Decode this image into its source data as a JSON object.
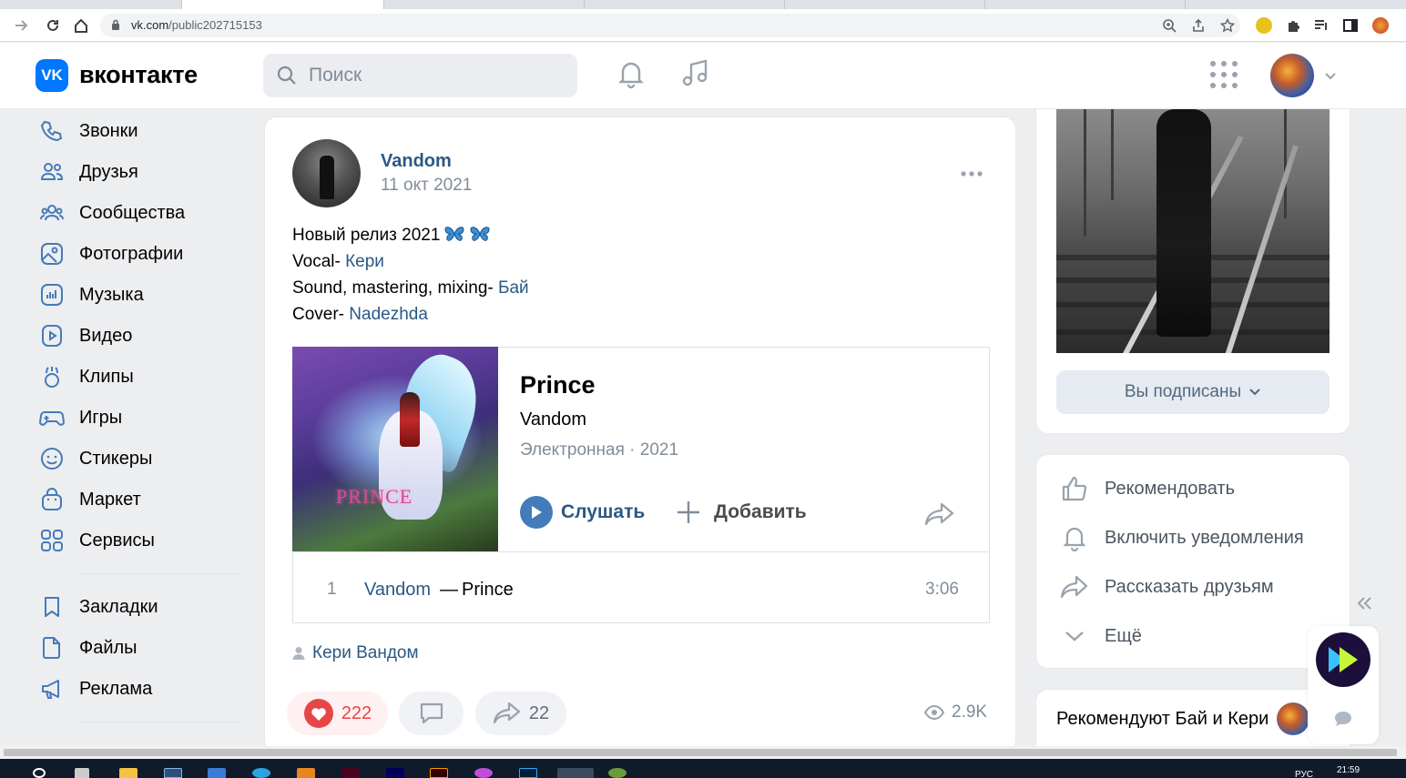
{
  "browser": {
    "url_host": "vk.com",
    "url_path": "/public202715153"
  },
  "header": {
    "logo_text": "VK",
    "brand": "вконтакте",
    "search_placeholder": "Поиск"
  },
  "menu": {
    "items": [
      {
        "label": "Звонки",
        "icon": "phone-icon"
      },
      {
        "label": "Друзья",
        "icon": "friends-icon"
      },
      {
        "label": "Сообщества",
        "icon": "communities-icon"
      },
      {
        "label": "Фотографии",
        "icon": "photos-icon"
      },
      {
        "label": "Музыка",
        "icon": "music-icon"
      },
      {
        "label": "Видео",
        "icon": "video-icon"
      },
      {
        "label": "Клипы",
        "icon": "clips-icon"
      },
      {
        "label": "Игры",
        "icon": "games-icon"
      },
      {
        "label": "Стикеры",
        "icon": "stickers-icon"
      },
      {
        "label": "Маркет",
        "icon": "market-icon"
      },
      {
        "label": "Сервисы",
        "icon": "services-icon"
      }
    ],
    "secondary": [
      {
        "label": "Закладки",
        "icon": "bookmark-icon"
      },
      {
        "label": "Файлы",
        "icon": "file-icon"
      },
      {
        "label": "Реклама",
        "icon": "megaphone-icon"
      }
    ]
  },
  "post": {
    "author": "Vandom",
    "date": "11 окт 2021",
    "text": {
      "line1": "Новый релиз 2021",
      "line2_prefix": "Vocal- ",
      "line2_link": "Кери",
      "line3_prefix": "Sound, mastering, mixing- ",
      "line3_link": "Бай",
      "line4_prefix": "Cover- ",
      "line4_link": "Nadezhda"
    },
    "album": {
      "cover_title": "PRINCE",
      "title": "Prince",
      "artist": "Vandom",
      "genre": "Электронная",
      "separator": "·",
      "year": "2021",
      "listen_label": "Слушать",
      "add_label": "Добавить",
      "track": {
        "num": "1",
        "artist": "Vandom",
        "dash": "—",
        "name": "Prince",
        "duration": "3:06"
      }
    },
    "signer": "Кери Вандом",
    "likes": "222",
    "reposts": "22",
    "views": "2.9K"
  },
  "group": {
    "subscribed_label": "Вы подписаны",
    "actions": [
      {
        "label": "Рекомендовать",
        "icon": "thumbs-up-icon"
      },
      {
        "label": "Включить уведомления",
        "icon": "bell-icon"
      },
      {
        "label": "Рассказать друзьям",
        "icon": "share-icon"
      },
      {
        "label": "Ещё",
        "icon": "chevron-down-icon"
      }
    ],
    "recommend_label": "Рекомендуют Бай и Кери"
  },
  "taskbar": {
    "time": "21:59",
    "lang": "РУС"
  },
  "colors": {
    "accent": "#2a5885",
    "vk_blue": "#0077ff",
    "like_red": "#e64646",
    "background": "#edeef0"
  }
}
